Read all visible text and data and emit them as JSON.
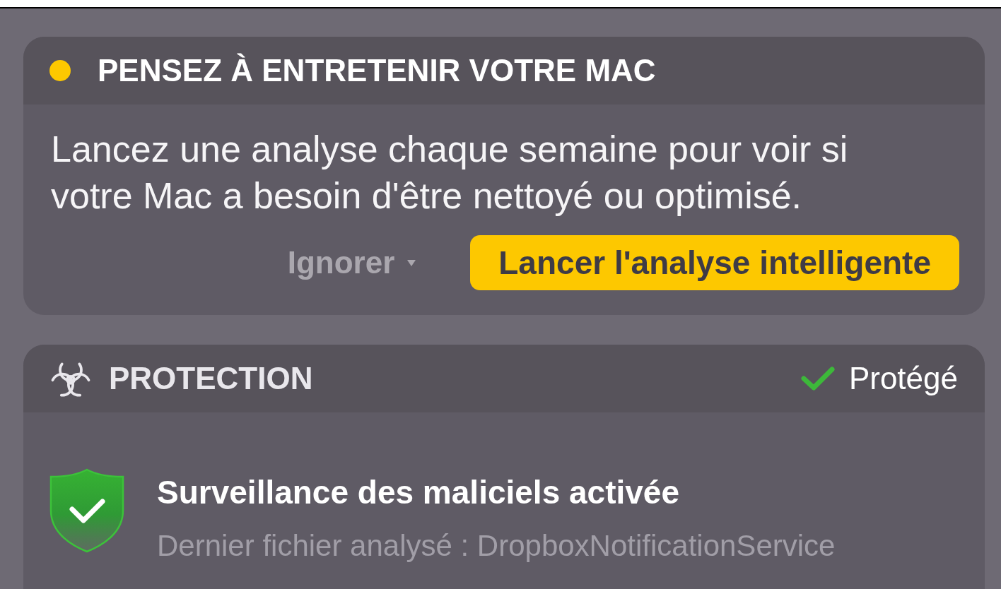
{
  "maintenance_card": {
    "title": "PENSEZ À ENTRETENIR VOTRE MAC",
    "message": "Lancez une analyse chaque semaine pour voir si votre Mac a besoin d'être nettoyé ou optimisé.",
    "dismiss_button": {
      "label": "Ignorer"
    },
    "action_button": {
      "label": "Lancer l'analyse intelligente"
    }
  },
  "protection_card": {
    "title": "PROTECTION",
    "status": "Protégé",
    "monitor": {
      "title": "Surveillance des maliciels activée",
      "detail": "Dernier fichier analysé : DropboxNotificationService"
    }
  }
}
